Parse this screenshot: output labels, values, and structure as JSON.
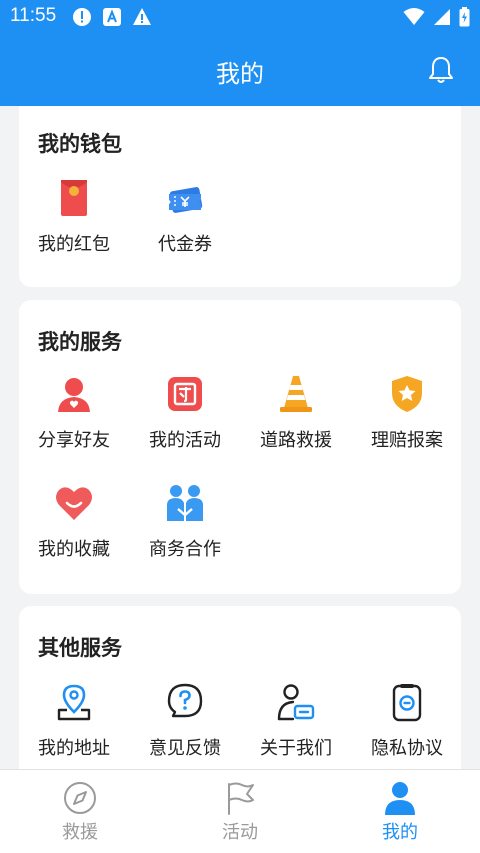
{
  "status_bar": {
    "time": "11:55"
  },
  "header": {
    "title": "我的"
  },
  "wallet": {
    "title": "我的钱包",
    "items": [
      {
        "label": "我的红包",
        "icon": "red-envelope-icon"
      },
      {
        "label": "代金券",
        "icon": "voucher-icon"
      }
    ]
  },
  "services": {
    "title": "我的服务",
    "items": [
      {
        "label": "分享好友",
        "icon": "share-friend-icon"
      },
      {
        "label": "我的活动",
        "icon": "activity-icon"
      },
      {
        "label": "道路救援",
        "icon": "traffic-cone-icon"
      },
      {
        "label": "理赔报案",
        "icon": "shield-star-icon"
      },
      {
        "label": "我的收藏",
        "icon": "heart-icon"
      },
      {
        "label": "商务合作",
        "icon": "partners-icon"
      }
    ]
  },
  "other": {
    "title": "其他服务",
    "items": [
      {
        "label": "我的地址",
        "icon": "location-pin-icon"
      },
      {
        "label": "意见反馈",
        "icon": "question-bubble-icon"
      },
      {
        "label": "关于我们",
        "icon": "person-card-icon"
      },
      {
        "label": "隐私协议",
        "icon": "privacy-document-icon"
      }
    ]
  },
  "tabbar": {
    "tabs": [
      {
        "label": "救援",
        "icon": "compass-icon",
        "active": false
      },
      {
        "label": "活动",
        "icon": "flag-icon",
        "active": false
      },
      {
        "label": "我的",
        "icon": "person-icon",
        "active": true
      }
    ]
  },
  "colors": {
    "brand": "#1e90f4",
    "red": "#ef4d4d",
    "orange": "#f5a623",
    "inactive": "#9a9a9a"
  }
}
